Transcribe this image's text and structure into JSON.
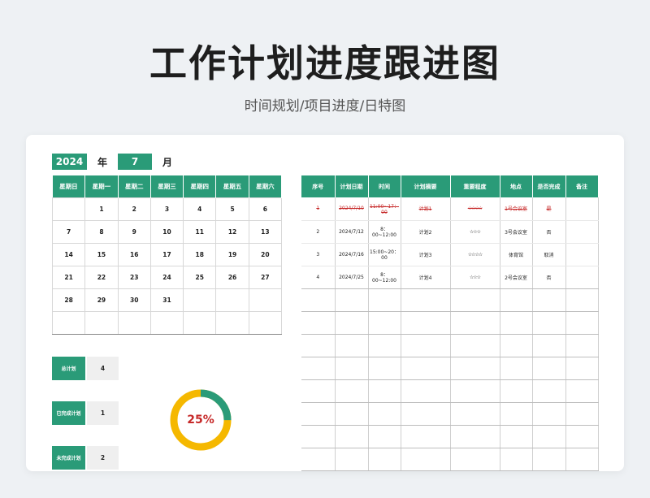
{
  "header": {
    "title": "工作计划进度跟进图",
    "subtitle": "时间规划/项目进度/日特图"
  },
  "calendar": {
    "year": "2024",
    "year_suffix": "年",
    "month": "7",
    "month_suffix": "月",
    "weekdays": [
      "星期日",
      "星期一",
      "星期二",
      "星期三",
      "星期四",
      "星期五",
      "星期六"
    ],
    "weeks": [
      [
        "",
        "1",
        "2",
        "3",
        "4",
        "5",
        "6"
      ],
      [
        "7",
        "8",
        "9",
        "10",
        "11",
        "12",
        "13"
      ],
      [
        "14",
        "15",
        "16",
        "17",
        "18",
        "19",
        "20"
      ],
      [
        "21",
        "22",
        "23",
        "24",
        "25",
        "26",
        "27"
      ],
      [
        "28",
        "29",
        "30",
        "31",
        "",
        "",
        ""
      ],
      [
        "",
        "",
        "",
        "",
        "",
        "",
        ""
      ]
    ]
  },
  "plan_table": {
    "headers": [
      "序号",
      "计划日期",
      "时间",
      "计划摘要",
      "重要程度",
      "地点",
      "是否完成",
      "备注"
    ],
    "rows": [
      {
        "no": "1",
        "date": "2024/7/10",
        "time": "11:00~17：00",
        "summary": "计划1",
        "importance": "☆☆☆☆",
        "place": "1号会议室",
        "done": "是",
        "note": "",
        "completed": true
      },
      {
        "no": "2",
        "date": "2024/7/12",
        "time": "8：00~12:00",
        "summary": "计划2",
        "importance": "☆☆☆",
        "place": "3号会议室",
        "done": "否",
        "note": "",
        "completed": false
      },
      {
        "no": "3",
        "date": "2024/7/16",
        "time": "15:00~20：00",
        "summary": "计划3",
        "importance": "☆☆☆☆",
        "place": "体育馆",
        "done": "取消",
        "note": "",
        "completed": false
      },
      {
        "no": "4",
        "date": "2024/7/25",
        "time": "8：00~12:00",
        "summary": "计划4",
        "importance": "☆☆☆",
        "place": "2号会议室",
        "done": "否",
        "note": "",
        "completed": false
      }
    ],
    "empty_rows": 8
  },
  "stats": {
    "total_label": "总计划",
    "total_value": "4",
    "done_label": "已完成计划",
    "done_value": "1",
    "undone_label": "未完成计划",
    "undone_value": "2",
    "percent_text": "25%",
    "percent": 0.25
  },
  "colors": {
    "accent": "#2a9b78",
    "ring": "#f5b800",
    "alert": "#c62828"
  }
}
